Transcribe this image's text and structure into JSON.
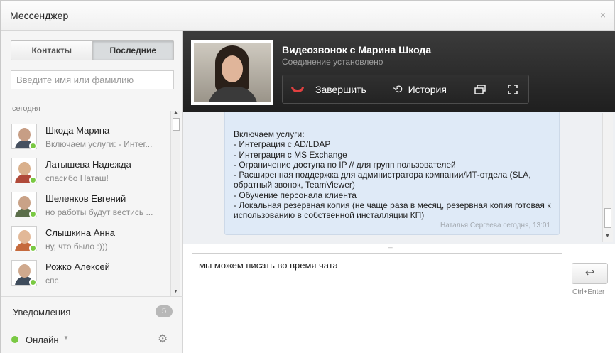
{
  "window": {
    "title": "Мессенджер",
    "close_glyph": "×"
  },
  "sidebar": {
    "tabs": [
      {
        "label": "Контакты",
        "active": false
      },
      {
        "label": "Последние",
        "active": true
      }
    ],
    "search_placeholder": "Введите имя или фамилию",
    "group_label": "сегодня",
    "contacts": [
      {
        "name": "Шкода Марина",
        "message": "Включаем услуги: - Интег...",
        "avatar_colors": [
          "#c79e85",
          "#46505f"
        ],
        "online": true
      },
      {
        "name": "Латышева Надежда",
        "message": "спасибо Наташ!",
        "avatar_colors": [
          "#d9b08c",
          "#b04a3a"
        ],
        "online": true
      },
      {
        "name": "Шеленков Евгений",
        "message": "но работы будут вестись ...",
        "avatar_colors": [
          "#c9a287",
          "#5b6e4a"
        ],
        "online": true
      },
      {
        "name": "Слышкина Анна",
        "message": "ну, что было :)))",
        "avatar_colors": [
          "#e2b897",
          "#c56a3d"
        ],
        "online": true
      },
      {
        "name": "Рожко Алексей",
        "message": "спс",
        "avatar_colors": [
          "#cfa98e",
          "#3f4c5c"
        ],
        "online": true
      }
    ],
    "notifications": {
      "label": "Уведомления",
      "count": "5"
    },
    "status": {
      "label": "Онлайн",
      "color": "#7ac943"
    }
  },
  "call": {
    "title": "Видеозвонок с Марина Шкода",
    "status": "Соединение установлено",
    "end_label": "Завершить",
    "history_label": "История"
  },
  "message": {
    "text": "Включаем услуги:\n- Интеграция с AD/LDAP\n- Интеграция с MS Exchange\n- Ограничение доступа по IP // для групп пользователей\n- Расширенная поддержка для администратора компании/ИТ-отдела (SLA, обратный звонок, TeamViewer)\n- Обучение персонала клиента\n- Локальная резервная копия (не чаще раза в месяц, резервная копия готовая к использованию в собственной инсталляции КП)",
    "meta": "Наталья Сергеева   сегодня, 13:01"
  },
  "composer": {
    "value": "мы можем писать во время чата",
    "send_hint": "Ctrl+Enter",
    "send_glyph": "↩"
  }
}
